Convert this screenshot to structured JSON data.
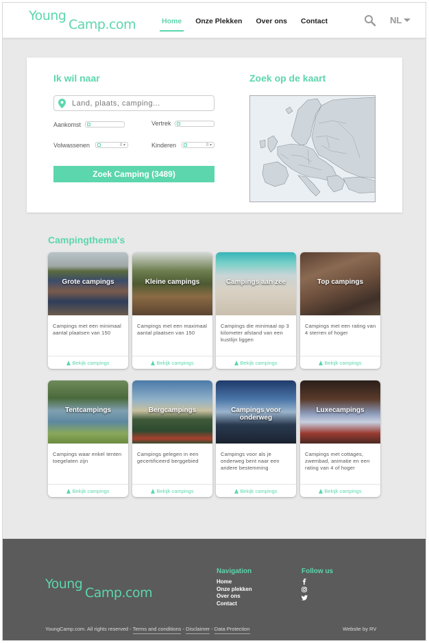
{
  "brand": {
    "line1": "Young",
    "line2": "Camp.com",
    "accent_color": "#5cd6ad"
  },
  "nav": {
    "items": [
      {
        "label": "Home",
        "active": true
      },
      {
        "label": "Onze Plekken",
        "active": false
      },
      {
        "label": "Over ons",
        "active": false
      },
      {
        "label": "Contact",
        "active": false
      }
    ],
    "search_icon": "search-icon",
    "language": "NL"
  },
  "search": {
    "heading": "Ik wil naar",
    "placeholder": "Land, plaats, camping...",
    "arrival_label": "Aankomst",
    "departure_label": "Vertrek",
    "adults_label": "Volwassenen",
    "adults_value": "0",
    "children_label": "Kinderen",
    "children_value": "0",
    "button_label": "Zoek Camping (3489)",
    "map_heading": "Zoek op de kaart"
  },
  "themes": {
    "title": "Campingthema's",
    "link_label": "Bekijk campings",
    "items": [
      {
        "title": "Grote campings",
        "desc": "Campings met een minimaal aantal plaatsen van 150"
      },
      {
        "title": "Kleine campings",
        "desc": "Campings met een maximaal aantal plaatsen van 150"
      },
      {
        "title": "Campings aan zee",
        "desc": "Campings die minimaal op 3 kilometer afstand van een kustlijn liggen"
      },
      {
        "title": "Top campings",
        "desc": "Campings met een rating van 4 sterren of hoger"
      },
      {
        "title": "Tentcampings",
        "desc": "Campings waar enkel tenten toegelaten zijn"
      },
      {
        "title": "Bergcampings",
        "desc": "Campings gelegen in een gecertificeerd berggebied"
      },
      {
        "title": "Campings voor onderweg",
        "desc": "Campings voor als je onderweg bent naar een andere bestemming"
      },
      {
        "title": "Luxecampings",
        "desc": "Campings met cottages, zwembad, animatie en een rating van 4 of hoger"
      }
    ]
  },
  "footer": {
    "nav_title": "Navigation",
    "nav_links": [
      "Home",
      "Onze plekken",
      "Over ons",
      "Contact"
    ],
    "follow_title": "Follow us",
    "social_icons": [
      "facebook-icon",
      "instagram-icon",
      "twitter-icon"
    ],
    "copyright": "YoungCamp.com. All rights reserved - ",
    "terms": "Terms and conditions",
    "sep": " - ",
    "disclaimer": "Disclaimer",
    "privacy": "Data Protection",
    "credit": "Website by RV"
  }
}
